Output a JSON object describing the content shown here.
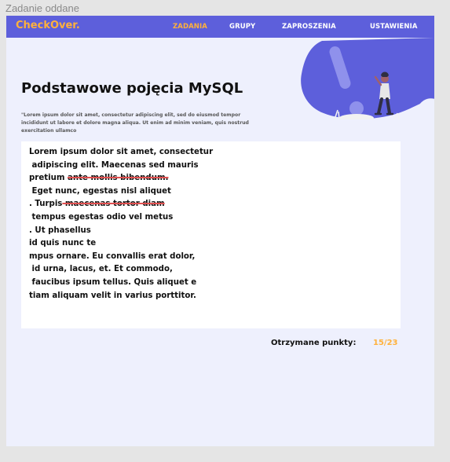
{
  "frame_title": "Zadanie oddane",
  "navbar": {
    "logo": "CheckOver.",
    "items": [
      {
        "label": "ZADANIA",
        "active": true
      },
      {
        "label": "GRUPY",
        "active": false
      },
      {
        "label": "ZAPROSZENIA",
        "active": false
      },
      {
        "label": "USTAWIENIA",
        "active": false
      }
    ]
  },
  "colors": {
    "accent": "#5d5fdb",
    "brand": "#ffb13b",
    "background": "#eef0fd",
    "strike": "#e05050"
  },
  "hero": {
    "icon": "exclamation-illustration"
  },
  "task": {
    "title": "Podstawowe pojęcia MySQL",
    "description": "\"Lorem ipsum dolor sit amet, consectetur adipiscing elit, sed do eiusmod tempor incididunt ut labore et dolore magna aliqua. Ut enim ad minim veniam, quis nostrud exercitation ullamco"
  },
  "answer": {
    "lines": [
      [
        {
          "text": "Lorem ipsum dolor sit amet, consectetur",
          "strike": false
        }
      ],
      [
        {
          "text": " adipiscing elit. Maecenas sed mauris",
          "strike": false
        }
      ],
      [
        {
          "text": "pretium ",
          "strike": false
        },
        {
          "text": "ante mollis bibendum.",
          "strike": true
        }
      ],
      [
        {
          "text": " Eget nunc, egestas nisl aliquet",
          "strike": false
        }
      ],
      [
        {
          "text": ". Turpis",
          "strike": false
        },
        {
          "text": " maecenas tortor diam",
          "strike": true
        }
      ],
      [
        {
          "text": " tempus egestas odio vel metus",
          "strike": false
        }
      ],
      [
        {
          "text": ". Ut phasellus",
          "strike": false
        }
      ],
      [
        {
          "text": "id quis nunc te",
          "strike": false
        }
      ],
      [
        {
          "text": "mpus ornare. Eu convallis erat dolor,",
          "strike": false
        }
      ],
      [
        {
          "text": " id urna, lacus, et. Et commodo,",
          "strike": false
        }
      ],
      [
        {
          "text": " faucibus ipsum tellus. Quis aliquet e",
          "strike": false
        }
      ],
      [
        {
          "text": "tiam aliquam velit in varius porttitor.",
          "strike": false
        }
      ]
    ]
  },
  "score": {
    "label": "Otrzymane punkty:",
    "value": "15/23"
  }
}
